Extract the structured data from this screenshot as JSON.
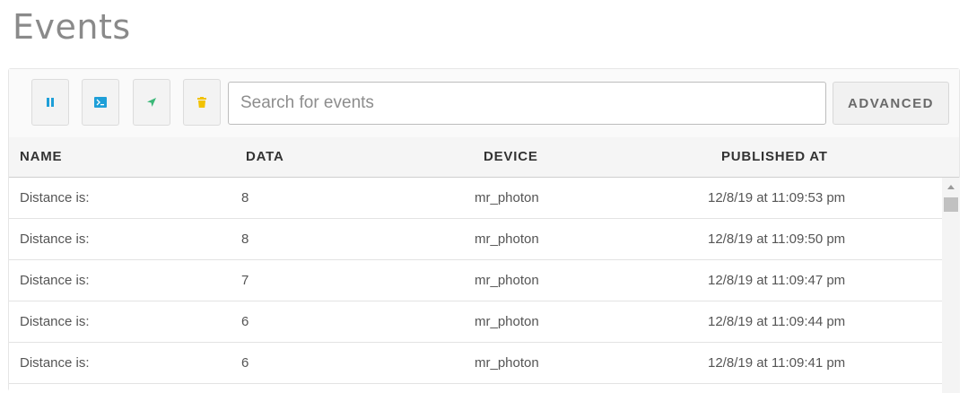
{
  "header": {
    "title": "Events"
  },
  "toolbar": {
    "buttons": [
      {
        "name": "pause-button",
        "icon": "pause-icon",
        "color": "#1e9fd8"
      },
      {
        "name": "terminal-button",
        "icon": "terminal-icon",
        "color": "#1e9fd8"
      },
      {
        "name": "publish-button",
        "icon": "send-icon",
        "color": "#3bb878"
      },
      {
        "name": "clear-button",
        "icon": "trash-icon",
        "color": "#f2c200"
      }
    ],
    "search_placeholder": "Search for events",
    "search_value": "",
    "advanced_label": "ADVANCED"
  },
  "table": {
    "columns": [
      "NAME",
      "DATA",
      "DEVICE",
      "PUBLISHED AT"
    ],
    "rows": [
      {
        "name": "Distance is:",
        "data": "8",
        "device": "mr_photon",
        "published_at": "12/8/19 at 11:09:53 pm"
      },
      {
        "name": "Distance is:",
        "data": "8",
        "device": "mr_photon",
        "published_at": "12/8/19 at 11:09:50 pm"
      },
      {
        "name": "Distance is:",
        "data": "7",
        "device": "mr_photon",
        "published_at": "12/8/19 at 11:09:47 pm"
      },
      {
        "name": "Distance is:",
        "data": "6",
        "device": "mr_photon",
        "published_at": "12/8/19 at 11:09:44 pm"
      },
      {
        "name": "Distance is:",
        "data": "6",
        "device": "mr_photon",
        "published_at": "12/8/19 at 11:09:41 pm"
      }
    ]
  }
}
